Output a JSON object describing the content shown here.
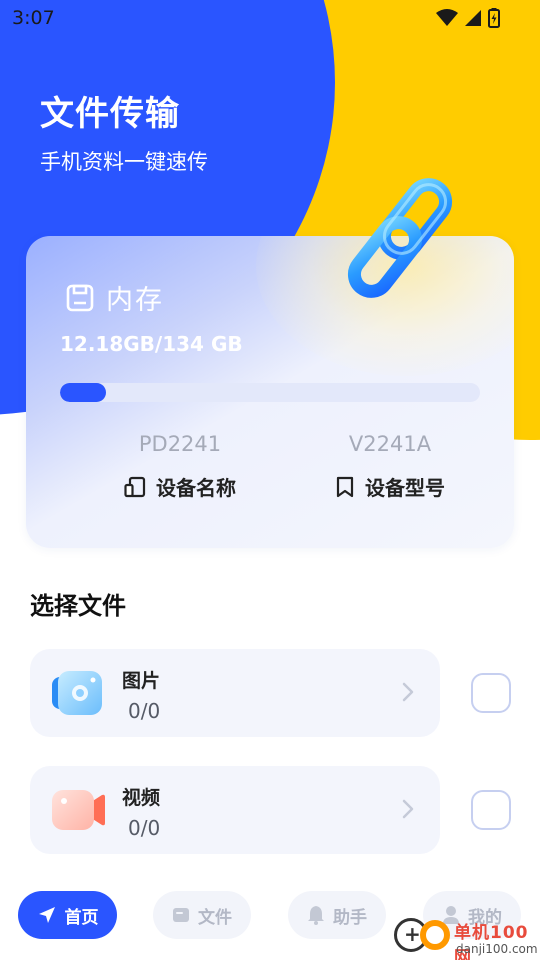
{
  "status_bar": {
    "time": "3:07",
    "icons": [
      "wifi-icon",
      "signal-icon",
      "battery-icon"
    ]
  },
  "header": {
    "title": "文件传输",
    "subtitle": "手机资料一键速传"
  },
  "storage": {
    "title": "内存",
    "usage": "12.18GB/134 GB",
    "used_fraction": 0.09,
    "device": {
      "name_value": "PD2241",
      "name_label": "设备名称",
      "model_value": "V2241A",
      "model_label": "设备型号"
    }
  },
  "select_section": {
    "title": "选择文件"
  },
  "file_types": [
    {
      "name": "图片",
      "count": "0/0",
      "icon": "image-icon",
      "checked": false
    },
    {
      "name": "视频",
      "count": "0/0",
      "icon": "video-icon",
      "checked": false
    }
  ],
  "bottom_nav": [
    {
      "label": "首页",
      "icon": "send-icon",
      "active": true
    },
    {
      "label": "文件",
      "icon": "folder-icon",
      "active": false
    },
    {
      "label": "助手",
      "icon": "bell-icon",
      "active": false
    },
    {
      "label": "我的",
      "icon": "user-icon",
      "active": false
    }
  ],
  "watermark": {
    "name": "单机100网",
    "url": "danji100.com"
  },
  "colors": {
    "primary_blue": "#2a55ff",
    "accent_yellow": "#ffcc00",
    "card_bg": "#f3f5fc"
  }
}
